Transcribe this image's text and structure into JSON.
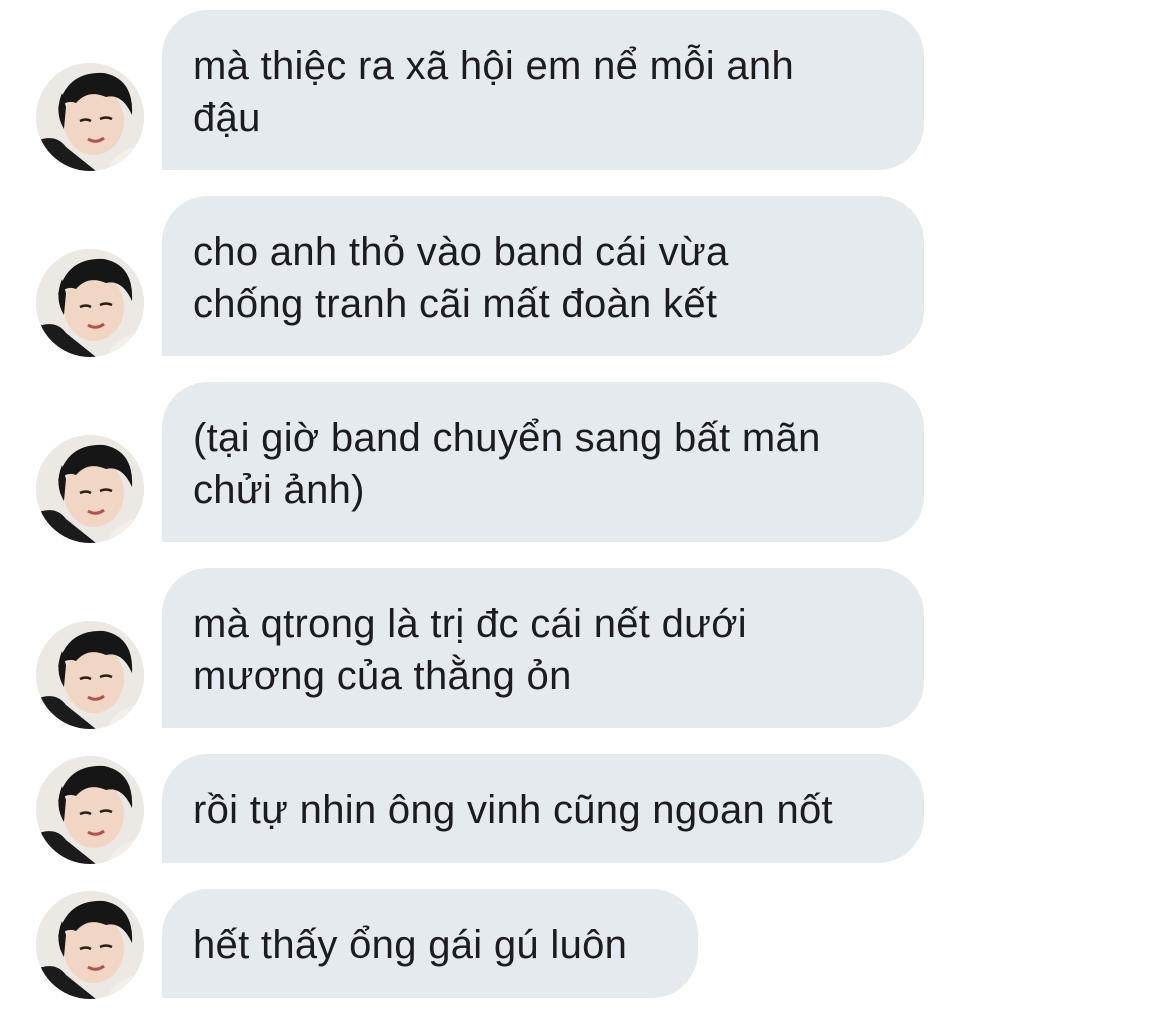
{
  "conversation": {
    "messages": [
      {
        "lines": [
          "mà thiệc ra xã hội em nể mỗi anh",
          "đậu"
        ]
      },
      {
        "lines": [
          "cho anh thỏ vào band cái vừa",
          "chống tranh cãi mất đoàn kết"
        ]
      },
      {
        "lines": [
          "(tại giờ band chuyển sang bất mãn",
          "chửi ảnh)"
        ]
      },
      {
        "lines": [
          "mà qtrong là trị đc cái nết dưới",
          "mương của thằng ỏn"
        ]
      },
      {
        "lines": [
          "rồi tự nhin ông vinh cũng ngoan nốt"
        ]
      },
      {
        "lines": [
          "hết thấy ổng gái gú luôn"
        ]
      }
    ]
  },
  "colors": {
    "bubble_background": "#e5eaee",
    "text": "#1c1c1e",
    "page_background": "#ffffff"
  },
  "icons": {
    "sender_avatar": "sender-avatar-photo"
  }
}
